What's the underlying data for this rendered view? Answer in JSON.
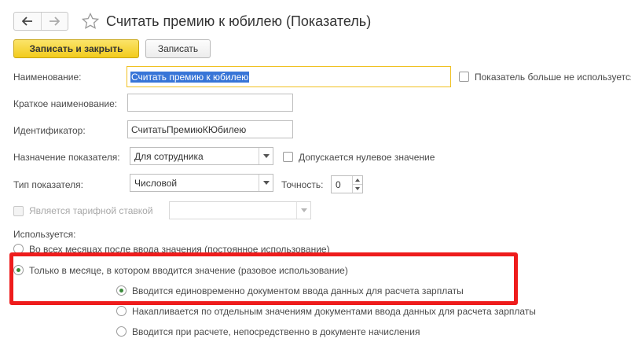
{
  "window": {
    "title": "Считать премию к юбилею (Показатель)"
  },
  "toolbar": {
    "back_icon": "arrow-left-icon",
    "forward_icon": "arrow-right-icon",
    "favorite_icon": "star-icon",
    "save_close_label": "Записать и закрыть",
    "save_label": "Записать"
  },
  "form": {
    "name_label": "Наименование:",
    "name_value": "Считать премию к юбилею",
    "not_used_label": "Показатель больше не используется",
    "short_name_label": "Краткое наименование:",
    "short_name_value": "",
    "identifier_label": "Идентификатор:",
    "identifier_value": "СчитатьПремиюКЮбилею",
    "purpose_label": "Назначение показателя:",
    "purpose_value": "Для сотрудника",
    "zero_allowed_label": "Допускается нулевое значение",
    "type_label": "Тип показателя:",
    "type_value": "Числовой",
    "precision_label": "Точность:",
    "precision_value": "0",
    "tariff_label": "Является тарифной ставкой",
    "tariff_value": "",
    "usage_label": "Используется:",
    "usage_option_all_months": "Во всех месяцах после ввода значения (постоянное использование)",
    "usage_option_one_month": "Только в месяце, в котором вводится значение (разовое использование)",
    "sub_option_single_doc": "Вводится единовременно документом ввода данных для расчета зарплаты",
    "sub_option_accumulated": "Накапливается по отдельным значениям документами ввода данных для расчета зарплаты",
    "sub_option_on_calc": "Вводится при расчете, непосредственно в документе начисления"
  },
  "colors": {
    "accent": "#f2cb1c",
    "highlight": "#ee1c1c",
    "selection": "#3875d7"
  }
}
